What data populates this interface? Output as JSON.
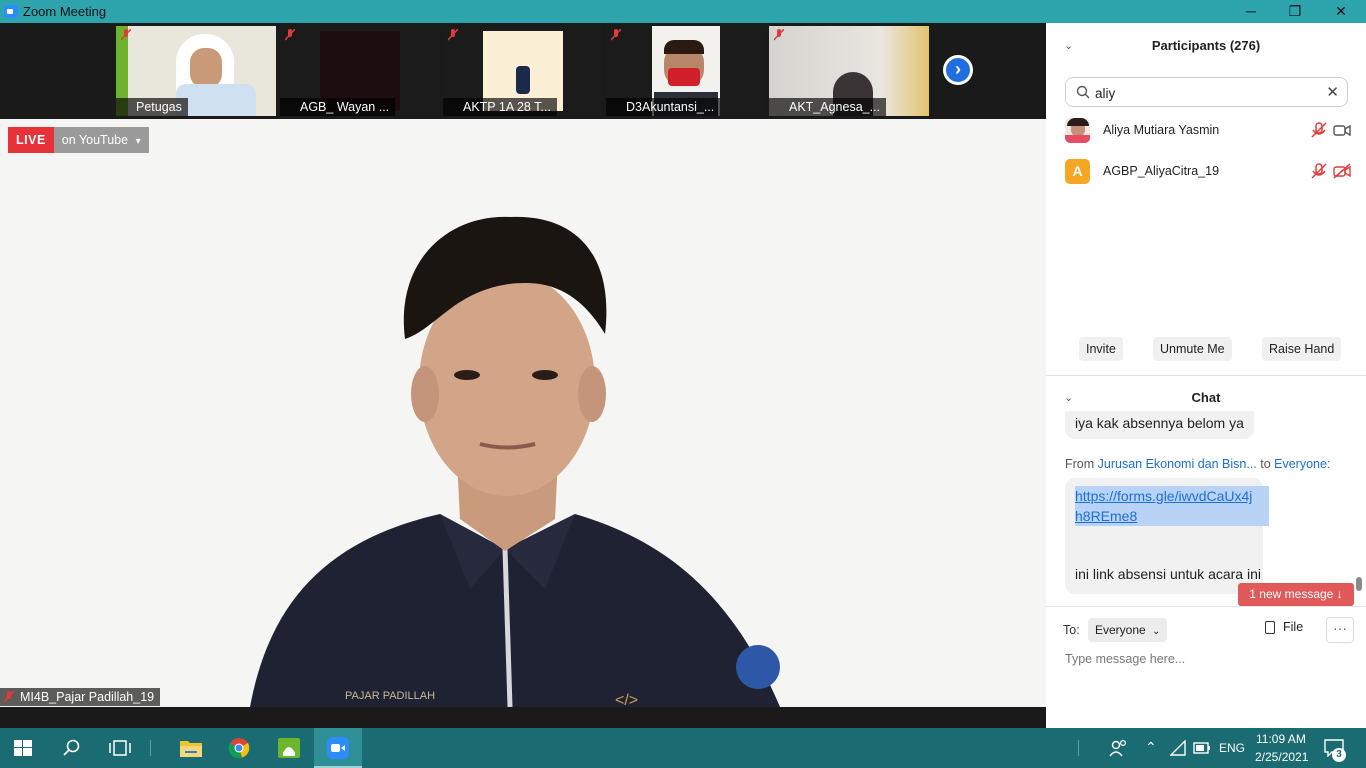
{
  "window": {
    "title": "Zoom Meeting",
    "minimize": "─",
    "maximize": "❐",
    "close": "✕"
  },
  "gallery": {
    "tiles": [
      {
        "name": "Petugas"
      },
      {
        "name": "AGB_ Wayan ..."
      },
      {
        "name": "AKTP 1A 28 T..."
      },
      {
        "name": "D3Akuntansi_..."
      },
      {
        "name": "AKT_Agnesa_..."
      }
    ],
    "next_icon": "›"
  },
  "stream": {
    "live_label": "LIVE",
    "platform_label": "on YouTube",
    "dropdown_icon": "▾"
  },
  "speaker": {
    "name": "MI4B_Pajar Padillah_19"
  },
  "participants": {
    "title": "Participants (276)",
    "search_value": "aliy",
    "clear_icon": "✕",
    "list": [
      {
        "name": "Aliya Mutiara Yasmin",
        "avatar_type": "photo",
        "mic": "muted",
        "video": "on"
      },
      {
        "name": "AGBP_AliyaCitra_19",
        "avatar_letter": "A",
        "avatar_color": "#f5a623",
        "mic": "muted",
        "video": "off"
      }
    ],
    "buttons": {
      "invite": "Invite",
      "unmute": "Unmute Me",
      "raise_hand": "Raise Hand"
    }
  },
  "chat": {
    "title": "Chat",
    "prev_message": "iya kak absennya belom ya",
    "from_prefix": "From ",
    "from_sender": "Jurusan Ekonomi dan Bisn...",
    "from_to": " to ",
    "from_recipient": "Everyone:",
    "link_line1": "https://forms.gle/iwvdCaUx4j",
    "link_line2": "h8REme8",
    "message_text": "ini link absensi untuk acara ini",
    "new_message": "1 new message ↓",
    "to_label": "To:",
    "to_value": "Everyone",
    "file_label": "File",
    "more_label": "···",
    "input_placeholder": "Type message here..."
  },
  "taskbar": {
    "time": "11:09 AM",
    "date": "2/25/2021",
    "language": "ENG",
    "notification_count": "3"
  },
  "colors": {
    "titlebar": "#2ea5ad",
    "live_red": "#e8323a",
    "link_blue": "#1a6fd6",
    "new_message": "#e05a5a",
    "taskbar": "#1b6b72"
  }
}
